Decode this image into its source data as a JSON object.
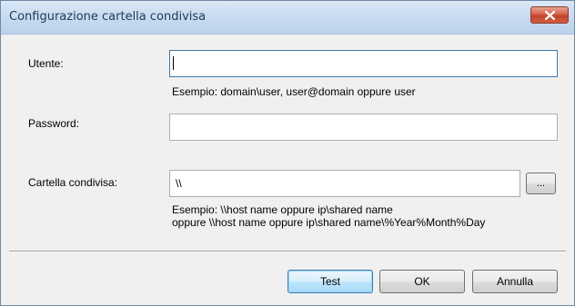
{
  "window": {
    "title": "Configurazione cartella condivisa",
    "close_icon": "close-x"
  },
  "form": {
    "user": {
      "label": "Utente:",
      "value": "",
      "hint": "Esempio: domain\\user, user@domain oppure user"
    },
    "password": {
      "label": "Password:",
      "value": ""
    },
    "shared_folder": {
      "label": "Cartella condivisa:",
      "value": "\\\\",
      "browse_label": "...",
      "hint_line1": "Esempio: \\\\host name oppure ip\\shared name",
      "hint_line2": "oppure \\\\host name oppure ip\\shared name\\%Year%Month%Day"
    }
  },
  "buttons": {
    "test": "Test",
    "ok": "OK",
    "cancel": "Annulla"
  }
}
